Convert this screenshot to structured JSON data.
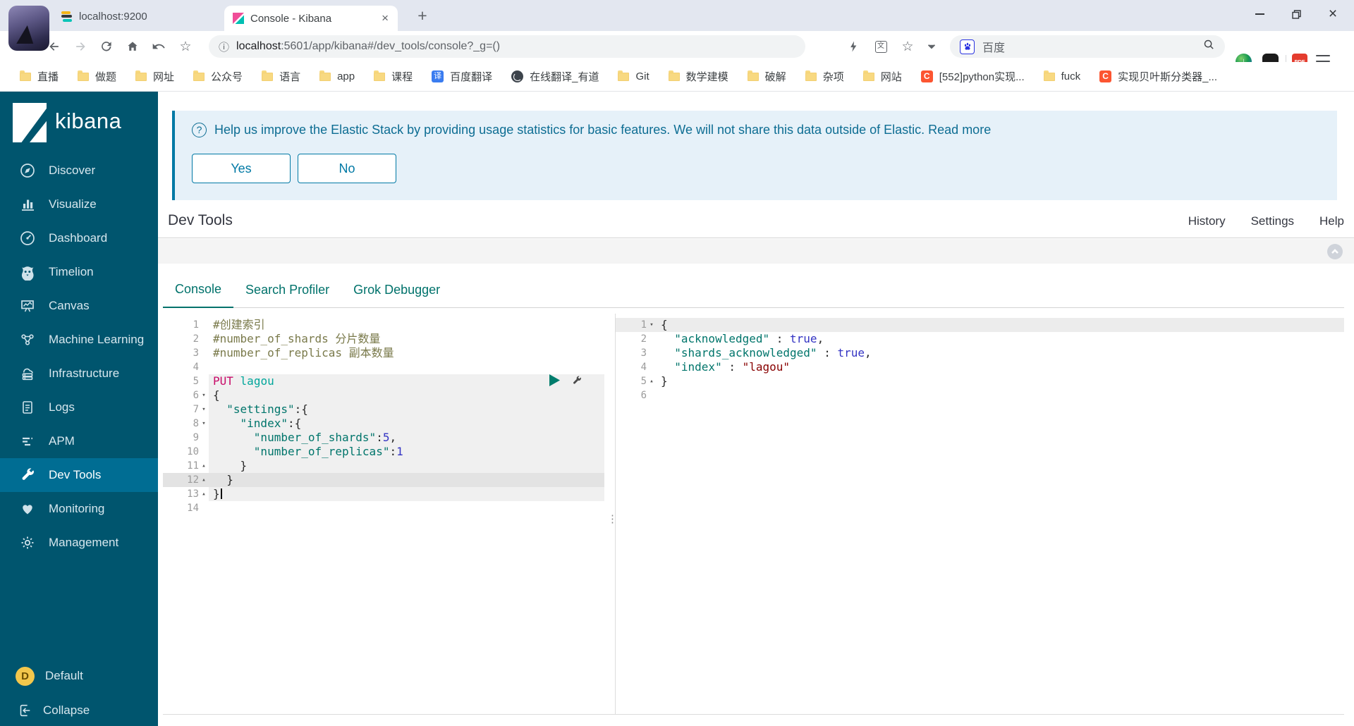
{
  "browser": {
    "tabs": [
      {
        "title": "localhost:9200",
        "icon": "elasticsearch"
      },
      {
        "title": "Console - Kibana",
        "icon": "kibana",
        "active": true
      }
    ],
    "url": {
      "host": "localhost",
      "path": ":5601/app/kibana#/dev_tools/console?_g=()"
    },
    "search": {
      "label": "百度"
    },
    "bookmarks": [
      {
        "label": "直播",
        "icon": "folder"
      },
      {
        "label": "做题",
        "icon": "folder"
      },
      {
        "label": "网址",
        "icon": "folder"
      },
      {
        "label": "公众号",
        "icon": "folder"
      },
      {
        "label": "语言",
        "icon": "folder"
      },
      {
        "label": "app",
        "icon": "folder"
      },
      {
        "label": "课程",
        "icon": "folder"
      },
      {
        "label": "百度翻译",
        "icon": "translate"
      },
      {
        "label": "在线翻译_有道",
        "icon": "globe"
      },
      {
        "label": "Git",
        "icon": "folder"
      },
      {
        "label": "数学建模",
        "icon": "folder"
      },
      {
        "label": "破解",
        "icon": "folder"
      },
      {
        "label": "杂项",
        "icon": "folder"
      },
      {
        "label": "网站",
        "icon": "folder"
      },
      {
        "label": "[552]python实现...",
        "icon": "csdn"
      },
      {
        "label": "fuck",
        "icon": "folder"
      },
      {
        "label": "实现贝叶斯分类器_...",
        "icon": "csdn"
      }
    ]
  },
  "sidebar": {
    "logo": "kibana",
    "items": [
      {
        "label": "Discover",
        "icon": "discover"
      },
      {
        "label": "Visualize",
        "icon": "visualize"
      },
      {
        "label": "Dashboard",
        "icon": "dashboard"
      },
      {
        "label": "Timelion",
        "icon": "timelion"
      },
      {
        "label": "Canvas",
        "icon": "canvas"
      },
      {
        "label": "Machine Learning",
        "icon": "ml"
      },
      {
        "label": "Infrastructure",
        "icon": "infrastructure"
      },
      {
        "label": "Logs",
        "icon": "logs"
      },
      {
        "label": "APM",
        "icon": "apm"
      },
      {
        "label": "Dev Tools",
        "icon": "devtools",
        "active": true
      },
      {
        "label": "Monitoring",
        "icon": "monitoring"
      },
      {
        "label": "Management",
        "icon": "management"
      }
    ],
    "space": {
      "badge": "D",
      "label": "Default"
    },
    "collapse_label": "Collapse"
  },
  "banner": {
    "icon": "?",
    "text": "Help us improve the Elastic Stack by providing usage statistics for basic features. We will not share this data outside of Elastic.",
    "link": "Read more",
    "yes_label": "Yes",
    "no_label": "No"
  },
  "devtools": {
    "title": "Dev Tools",
    "links": [
      "History",
      "Settings",
      "Help"
    ],
    "tabs": [
      {
        "label": "Console",
        "active": true
      },
      {
        "label": "Search Profiler"
      },
      {
        "label": "Grok Debugger"
      }
    ]
  },
  "editor": {
    "request_lines": [
      {
        "n": 1,
        "s": [
          {
            "t": "#创建索引",
            "c": "cmt"
          }
        ]
      },
      {
        "n": 2,
        "s": [
          {
            "t": "#number_of_shards 分片数量",
            "c": "cmt"
          }
        ]
      },
      {
        "n": 3,
        "s": [
          {
            "t": "#number_of_replicas 副本数量",
            "c": "cmt"
          }
        ]
      },
      {
        "n": 4,
        "s": []
      },
      {
        "n": 5,
        "bg": "req",
        "s": [
          {
            "t": "PUT",
            "c": "mth"
          },
          {
            "t": " ",
            "c": "pun"
          },
          {
            "t": "lagou",
            "c": "url"
          }
        ]
      },
      {
        "n": 6,
        "fold": "open",
        "bg": "req",
        "s": [
          {
            "t": "{",
            "c": "pun"
          }
        ]
      },
      {
        "n": 7,
        "fold": "open",
        "bg": "req",
        "s": [
          {
            "t": "  ",
            "c": "pun"
          },
          {
            "t": "\"settings\"",
            "c": "str"
          },
          {
            "t": ":{",
            "c": "pun"
          }
        ]
      },
      {
        "n": 8,
        "fold": "open",
        "bg": "req",
        "s": [
          {
            "t": "    ",
            "c": "pun"
          },
          {
            "t": "\"index\"",
            "c": "str"
          },
          {
            "t": ":{",
            "c": "pun"
          }
        ]
      },
      {
        "n": 9,
        "bg": "req",
        "s": [
          {
            "t": "      ",
            "c": "pun"
          },
          {
            "t": "\"number_of_shards\"",
            "c": "str"
          },
          {
            "t": ":",
            "c": "pun"
          },
          {
            "t": "5",
            "c": "lit"
          },
          {
            "t": ",",
            "c": "pun"
          }
        ]
      },
      {
        "n": 10,
        "bg": "req",
        "s": [
          {
            "t": "      ",
            "c": "pun"
          },
          {
            "t": "\"number_of_replicas\"",
            "c": "str"
          },
          {
            "t": ":",
            "c": "pun"
          },
          {
            "t": "1",
            "c": "lit"
          }
        ]
      },
      {
        "n": 11,
        "fold": "close",
        "bg": "req",
        "s": [
          {
            "t": "    }",
            "c": "pun"
          }
        ]
      },
      {
        "n": 12,
        "fold": "close",
        "bg": "cur",
        "s": [
          {
            "t": "  }",
            "c": "pun"
          }
        ]
      },
      {
        "n": 13,
        "fold": "close",
        "bg": "req",
        "cursor": true,
        "s": [
          {
            "t": "}",
            "c": "pun"
          }
        ]
      },
      {
        "n": 14,
        "s": []
      }
    ],
    "response_lines": [
      {
        "n": 1,
        "fold": "open",
        "bg": "hl",
        "s": [
          {
            "t": "{",
            "c": "pun"
          }
        ]
      },
      {
        "n": 2,
        "s": [
          {
            "t": "  ",
            "c": "pun"
          },
          {
            "t": "\"acknowledged\"",
            "c": "str"
          },
          {
            "t": " : ",
            "c": "pun"
          },
          {
            "t": "true",
            "c": "lit"
          },
          {
            "t": ",",
            "c": "pun"
          }
        ]
      },
      {
        "n": 3,
        "s": [
          {
            "t": "  ",
            "c": "pun"
          },
          {
            "t": "\"shards_acknowledged\"",
            "c": "str"
          },
          {
            "t": " : ",
            "c": "pun"
          },
          {
            "t": "true",
            "c": "lit"
          },
          {
            "t": ",",
            "c": "pun"
          }
        ]
      },
      {
        "n": 4,
        "s": [
          {
            "t": "  ",
            "c": "pun"
          },
          {
            "t": "\"index\"",
            "c": "str"
          },
          {
            "t": " : ",
            "c": "pun"
          },
          {
            "t": "\"lagou\"",
            "c": "strv"
          }
        ]
      },
      {
        "n": 5,
        "fold": "close",
        "s": [
          {
            "t": "}",
            "c": "pun"
          }
        ]
      },
      {
        "n": 6,
        "s": []
      }
    ]
  },
  "colors": {
    "accent_teal": "#00726b",
    "primary_blue": "#0079a5",
    "sidebar_bg": "#00556e",
    "play_green": "#007d6d"
  }
}
